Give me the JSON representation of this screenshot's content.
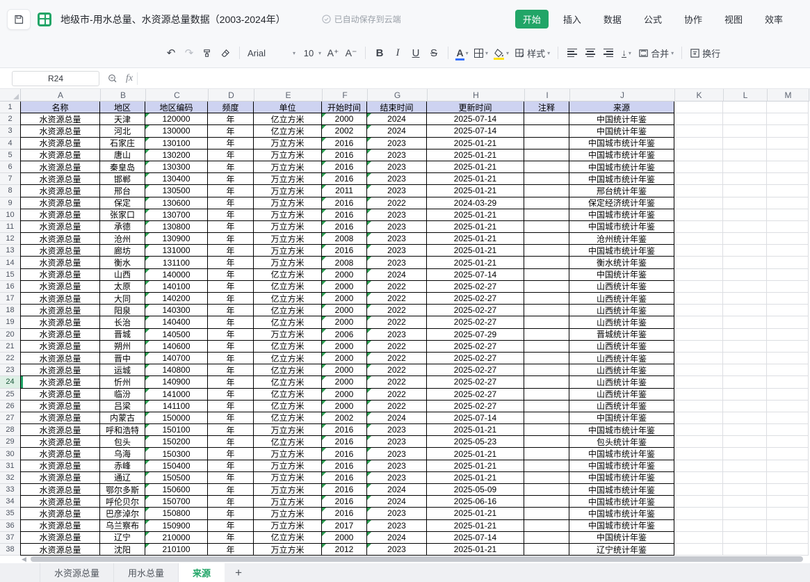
{
  "topbar": {
    "title": "地级市-用水总量、水资源总量数据（2003-2024年）",
    "autosave": "已自动保存到云端",
    "menus": [
      "开始",
      "插入",
      "数据",
      "公式",
      "协作",
      "视图",
      "效率"
    ],
    "active_menu": "开始"
  },
  "toolbar": {
    "font_name": "Arial",
    "font_size": "10",
    "bold_label": "B",
    "italic_label": "I",
    "underline_label": "U",
    "strike_label": "S",
    "font_color_label": "A",
    "style_label": "样式",
    "merge_label": "合并",
    "wrap_label": "换行"
  },
  "formula_bar": {
    "name_box": "R24",
    "formula": ""
  },
  "grid": {
    "column_letters": [
      "A",
      "B",
      "C",
      "D",
      "E",
      "F",
      "G",
      "H",
      "I",
      "J",
      "K",
      "L",
      "M"
    ],
    "header_row": [
      "名称",
      "地区",
      "地区编码",
      "频度",
      "单位",
      "开始时间",
      "结束时间",
      "更新时间",
      "注释",
      "来源"
    ],
    "text_marker_columns": [
      2,
      5,
      6
    ],
    "first_data_row_number": 2,
    "selected_row": 24,
    "selected_cell": "R24",
    "rows": [
      [
        "水资源总量",
        "天津",
        "120000",
        "年",
        "亿立方米",
        "2000",
        "2024",
        "2025-07-14",
        "",
        "中国统计年鉴"
      ],
      [
        "水资源总量",
        "河北",
        "130000",
        "年",
        "亿立方米",
        "2002",
        "2024",
        "2025-07-14",
        "",
        "中国统计年鉴"
      ],
      [
        "水资源总量",
        "石家庄",
        "130100",
        "年",
        "万立方米",
        "2016",
        "2023",
        "2025-01-21",
        "",
        "中国城市统计年鉴"
      ],
      [
        "水资源总量",
        "唐山",
        "130200",
        "年",
        "万立方米",
        "2016",
        "2023",
        "2025-01-21",
        "",
        "中国城市统计年鉴"
      ],
      [
        "水资源总量",
        "秦皇岛",
        "130300",
        "年",
        "万立方米",
        "2016",
        "2023",
        "2025-01-21",
        "",
        "中国城市统计年鉴"
      ],
      [
        "水资源总量",
        "邯郸",
        "130400",
        "年",
        "万立方米",
        "2016",
        "2023",
        "2025-01-21",
        "",
        "中国城市统计年鉴"
      ],
      [
        "水资源总量",
        "邢台",
        "130500",
        "年",
        "万立方米",
        "2011",
        "2023",
        "2025-01-21",
        "",
        "邢台统计年鉴"
      ],
      [
        "水资源总量",
        "保定",
        "130600",
        "年",
        "万立方米",
        "2016",
        "2022",
        "2024-03-29",
        "",
        "保定经济统计年鉴"
      ],
      [
        "水资源总量",
        "张家口",
        "130700",
        "年",
        "万立方米",
        "2016",
        "2023",
        "2025-01-21",
        "",
        "中国城市统计年鉴"
      ],
      [
        "水资源总量",
        "承德",
        "130800",
        "年",
        "万立方米",
        "2016",
        "2023",
        "2025-01-21",
        "",
        "中国城市统计年鉴"
      ],
      [
        "水资源总量",
        "沧州",
        "130900",
        "年",
        "万立方米",
        "2008",
        "2023",
        "2025-01-21",
        "",
        "沧州统计年鉴"
      ],
      [
        "水资源总量",
        "廊坊",
        "131000",
        "年",
        "万立方米",
        "2016",
        "2023",
        "2025-01-21",
        "",
        "中国城市统计年鉴"
      ],
      [
        "水资源总量",
        "衡水",
        "131100",
        "年",
        "万立方米",
        "2008",
        "2023",
        "2025-01-21",
        "",
        "衡水统计年鉴"
      ],
      [
        "水资源总量",
        "山西",
        "140000",
        "年",
        "亿立方米",
        "2000",
        "2024",
        "2025-07-14",
        "",
        "中国统计年鉴"
      ],
      [
        "水资源总量",
        "太原",
        "140100",
        "年",
        "亿立方米",
        "2000",
        "2022",
        "2025-02-27",
        "",
        "山西统计年鉴"
      ],
      [
        "水资源总量",
        "大同",
        "140200",
        "年",
        "亿立方米",
        "2000",
        "2022",
        "2025-02-27",
        "",
        "山西统计年鉴"
      ],
      [
        "水资源总量",
        "阳泉",
        "140300",
        "年",
        "亿立方米",
        "2000",
        "2022",
        "2025-02-27",
        "",
        "山西统计年鉴"
      ],
      [
        "水资源总量",
        "长治",
        "140400",
        "年",
        "亿立方米",
        "2000",
        "2022",
        "2025-02-27",
        "",
        "山西统计年鉴"
      ],
      [
        "水资源总量",
        "晋城",
        "140500",
        "年",
        "万立方米",
        "2006",
        "2023",
        "2025-07-29",
        "",
        "晋城统计年鉴"
      ],
      [
        "水资源总量",
        "朔州",
        "140600",
        "年",
        "亿立方米",
        "2000",
        "2022",
        "2025-02-27",
        "",
        "山西统计年鉴"
      ],
      [
        "水资源总量",
        "晋中",
        "140700",
        "年",
        "亿立方米",
        "2000",
        "2022",
        "2025-02-27",
        "",
        "山西统计年鉴"
      ],
      [
        "水资源总量",
        "运城",
        "140800",
        "年",
        "亿立方米",
        "2000",
        "2022",
        "2025-02-27",
        "",
        "山西统计年鉴"
      ],
      [
        "水资源总量",
        "忻州",
        "140900",
        "年",
        "亿立方米",
        "2000",
        "2022",
        "2025-02-27",
        "",
        "山西统计年鉴"
      ],
      [
        "水资源总量",
        "临汾",
        "141000",
        "年",
        "亿立方米",
        "2000",
        "2022",
        "2025-02-27",
        "",
        "山西统计年鉴"
      ],
      [
        "水资源总量",
        "吕梁",
        "141100",
        "年",
        "亿立方米",
        "2000",
        "2022",
        "2025-02-27",
        "",
        "山西统计年鉴"
      ],
      [
        "水资源总量",
        "内蒙古",
        "150000",
        "年",
        "亿立方米",
        "2002",
        "2024",
        "2025-07-14",
        "",
        "中国统计年鉴"
      ],
      [
        "水资源总量",
        "呼和浩特",
        "150100",
        "年",
        "万立方米",
        "2016",
        "2023",
        "2025-01-21",
        "",
        "中国城市统计年鉴"
      ],
      [
        "水资源总量",
        "包头",
        "150200",
        "年",
        "亿立方米",
        "2016",
        "2023",
        "2025-05-23",
        "",
        "包头统计年鉴"
      ],
      [
        "水资源总量",
        "乌海",
        "150300",
        "年",
        "万立方米",
        "2016",
        "2023",
        "2025-01-21",
        "",
        "中国城市统计年鉴"
      ],
      [
        "水资源总量",
        "赤峰",
        "150400",
        "年",
        "万立方米",
        "2016",
        "2023",
        "2025-01-21",
        "",
        "中国城市统计年鉴"
      ],
      [
        "水资源总量",
        "通辽",
        "150500",
        "年",
        "万立方米",
        "2016",
        "2023",
        "2025-01-21",
        "",
        "中国城市统计年鉴"
      ],
      [
        "水资源总量",
        "鄂尔多斯",
        "150600",
        "年",
        "万立方米",
        "2016",
        "2024",
        "2025-05-09",
        "",
        "中国城市统计年鉴"
      ],
      [
        "水资源总量",
        "呼伦贝尔",
        "150700",
        "年",
        "万立方米",
        "2016",
        "2024",
        "2025-06-16",
        "",
        "中国城市统计年鉴"
      ],
      [
        "水资源总量",
        "巴彦淖尔",
        "150800",
        "年",
        "万立方米",
        "2016",
        "2023",
        "2025-01-21",
        "",
        "中国城市统计年鉴"
      ],
      [
        "水资源总量",
        "乌兰察布",
        "150900",
        "年",
        "万立方米",
        "2017",
        "2023",
        "2025-01-21",
        "",
        "中国城市统计年鉴"
      ],
      [
        "水资源总量",
        "辽宁",
        "210000",
        "年",
        "亿立方米",
        "2000",
        "2024",
        "2025-07-14",
        "",
        "中国统计年鉴"
      ],
      [
        "水资源总量",
        "沈阳",
        "210100",
        "年",
        "万立方米",
        "2012",
        "2023",
        "2025-01-21",
        "",
        "辽宁统计年鉴"
      ]
    ]
  },
  "sheet_tabs": {
    "tabs": [
      "水资源总量",
      "用水总量",
      "来源"
    ],
    "active_tab": "来源",
    "add_label": "+"
  },
  "colors": {
    "accent_green": "#21a567",
    "header_fill": "#ced3f1",
    "marker_green": "#2e9e52"
  }
}
